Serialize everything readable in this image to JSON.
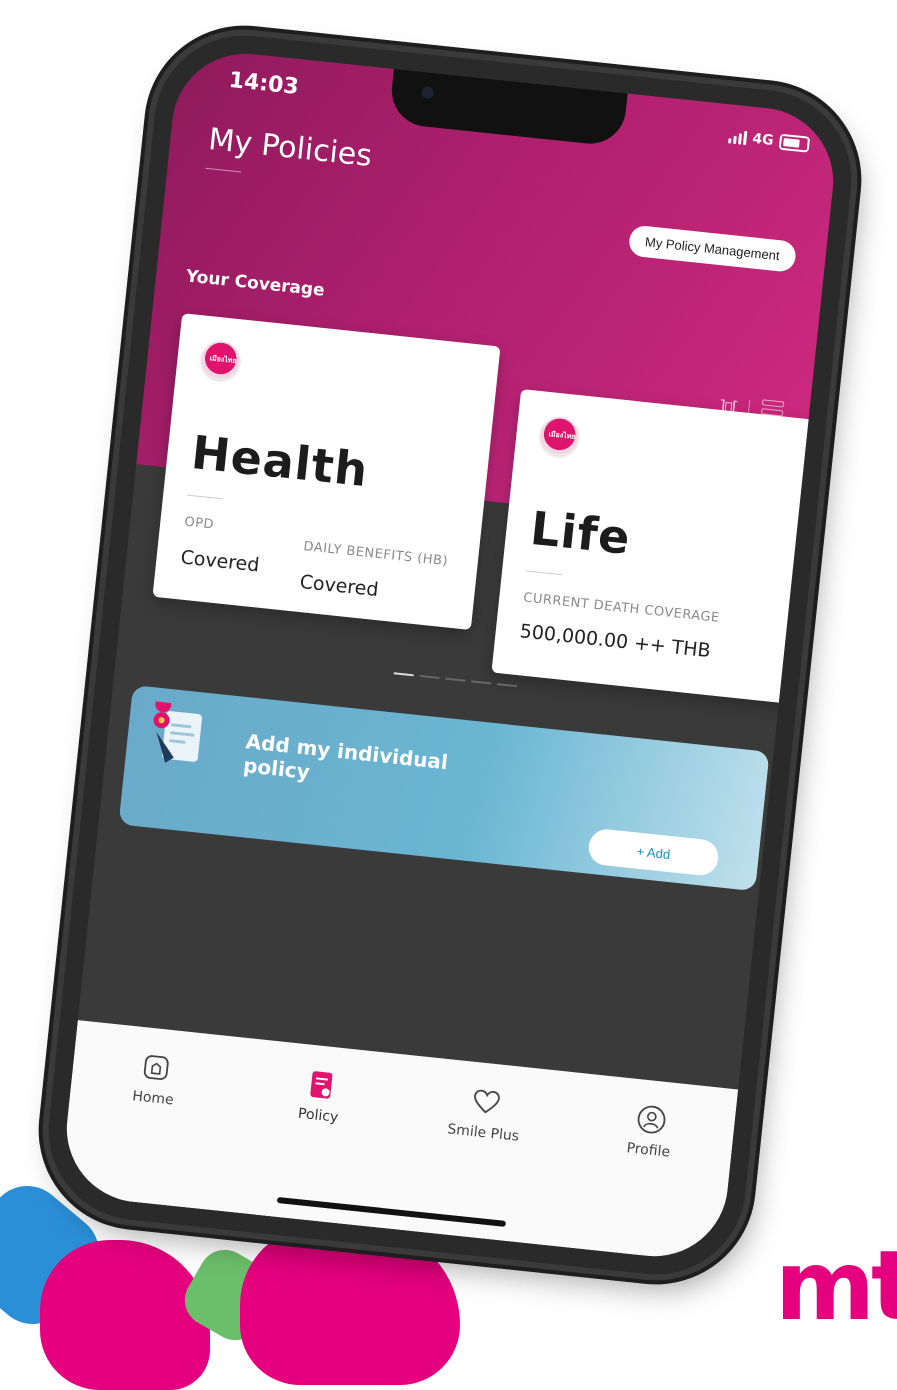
{
  "status_bar": {
    "time": "14:03",
    "network": "4G"
  },
  "header": {
    "title": "My Policies",
    "management_button": "My Policy Management"
  },
  "coverage": {
    "title": "Your Coverage",
    "cards": [
      {
        "type": "Health",
        "logo_text": "เมืองไทย",
        "fields": [
          {
            "label": "OPD",
            "value": "Covered"
          },
          {
            "label": "DAILY BENEFITS (HB)",
            "value": "Covered"
          }
        ]
      },
      {
        "type": "Life",
        "logo_text": "เมืองไทย",
        "fields": [
          {
            "label": "CURRENT DEATH COVERAGE",
            "value": "500,000.00 ++ THB"
          }
        ]
      }
    ],
    "pagination": {
      "total": 5,
      "active": 0
    }
  },
  "add_banner": {
    "text": "Add my individual policy",
    "button": "+ Add"
  },
  "tabbar": {
    "items": [
      {
        "label": "Home",
        "icon": "home-icon"
      },
      {
        "label": "Policy",
        "icon": "policy-icon",
        "active": true
      },
      {
        "label": "Smile Plus",
        "icon": "heart-icon"
      },
      {
        "label": "Profile",
        "icon": "profile-icon"
      }
    ]
  },
  "brand": {
    "mark": "mt",
    "colors": {
      "pink": "#e5007e",
      "blue": "#2b8fd8",
      "green": "#6cbf6a",
      "banner": "#69b6d3"
    }
  }
}
